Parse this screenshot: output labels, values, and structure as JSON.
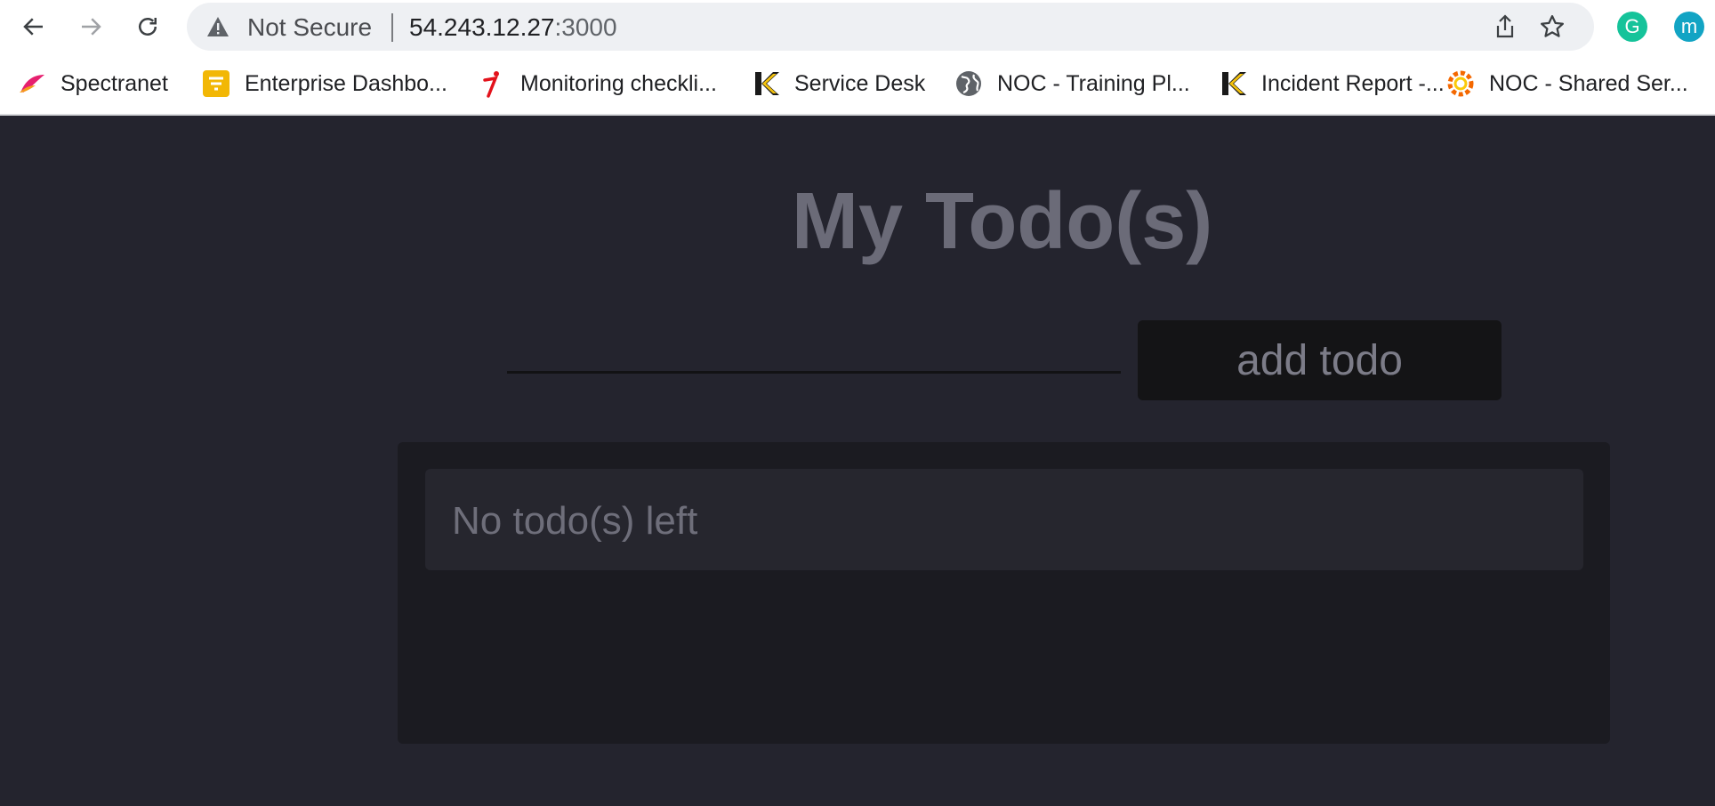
{
  "browser": {
    "security_label": "Not Secure",
    "url_host": "54.243.12.27",
    "url_port": ":3000",
    "extensions": [
      {
        "name": "grammarly",
        "glyph": "G",
        "color": "#15c39a"
      },
      {
        "name": "profile",
        "glyph": "m",
        "color": "#12a4c4"
      }
    ],
    "bookmarks": [
      {
        "label": "Spectranet",
        "icon": "spectranet-icon"
      },
      {
        "label": "Enterprise Dashbo...",
        "icon": "enterprise-dashboard-icon"
      },
      {
        "label": "Monitoring checkli...",
        "icon": "monitoring-icon"
      },
      {
        "label": "Service Desk",
        "icon": "service-desk-icon"
      },
      {
        "label": "NOC - Training Pl...",
        "icon": "globe-icon"
      },
      {
        "label": "Incident Report -...",
        "icon": "incident-report-icon"
      },
      {
        "label": "NOC - Shared Ser...",
        "icon": "grafana-icon"
      }
    ]
  },
  "app": {
    "title": "My Todo(s)",
    "input_value": "",
    "add_button_label": "add todo",
    "empty_message": "No todo(s) left"
  },
  "colors": {
    "page_background": "#24242e",
    "panel_background": "#1b1b21",
    "item_background": "#26262e",
    "title_color": "#6b6b78",
    "button_background": "#141416"
  }
}
